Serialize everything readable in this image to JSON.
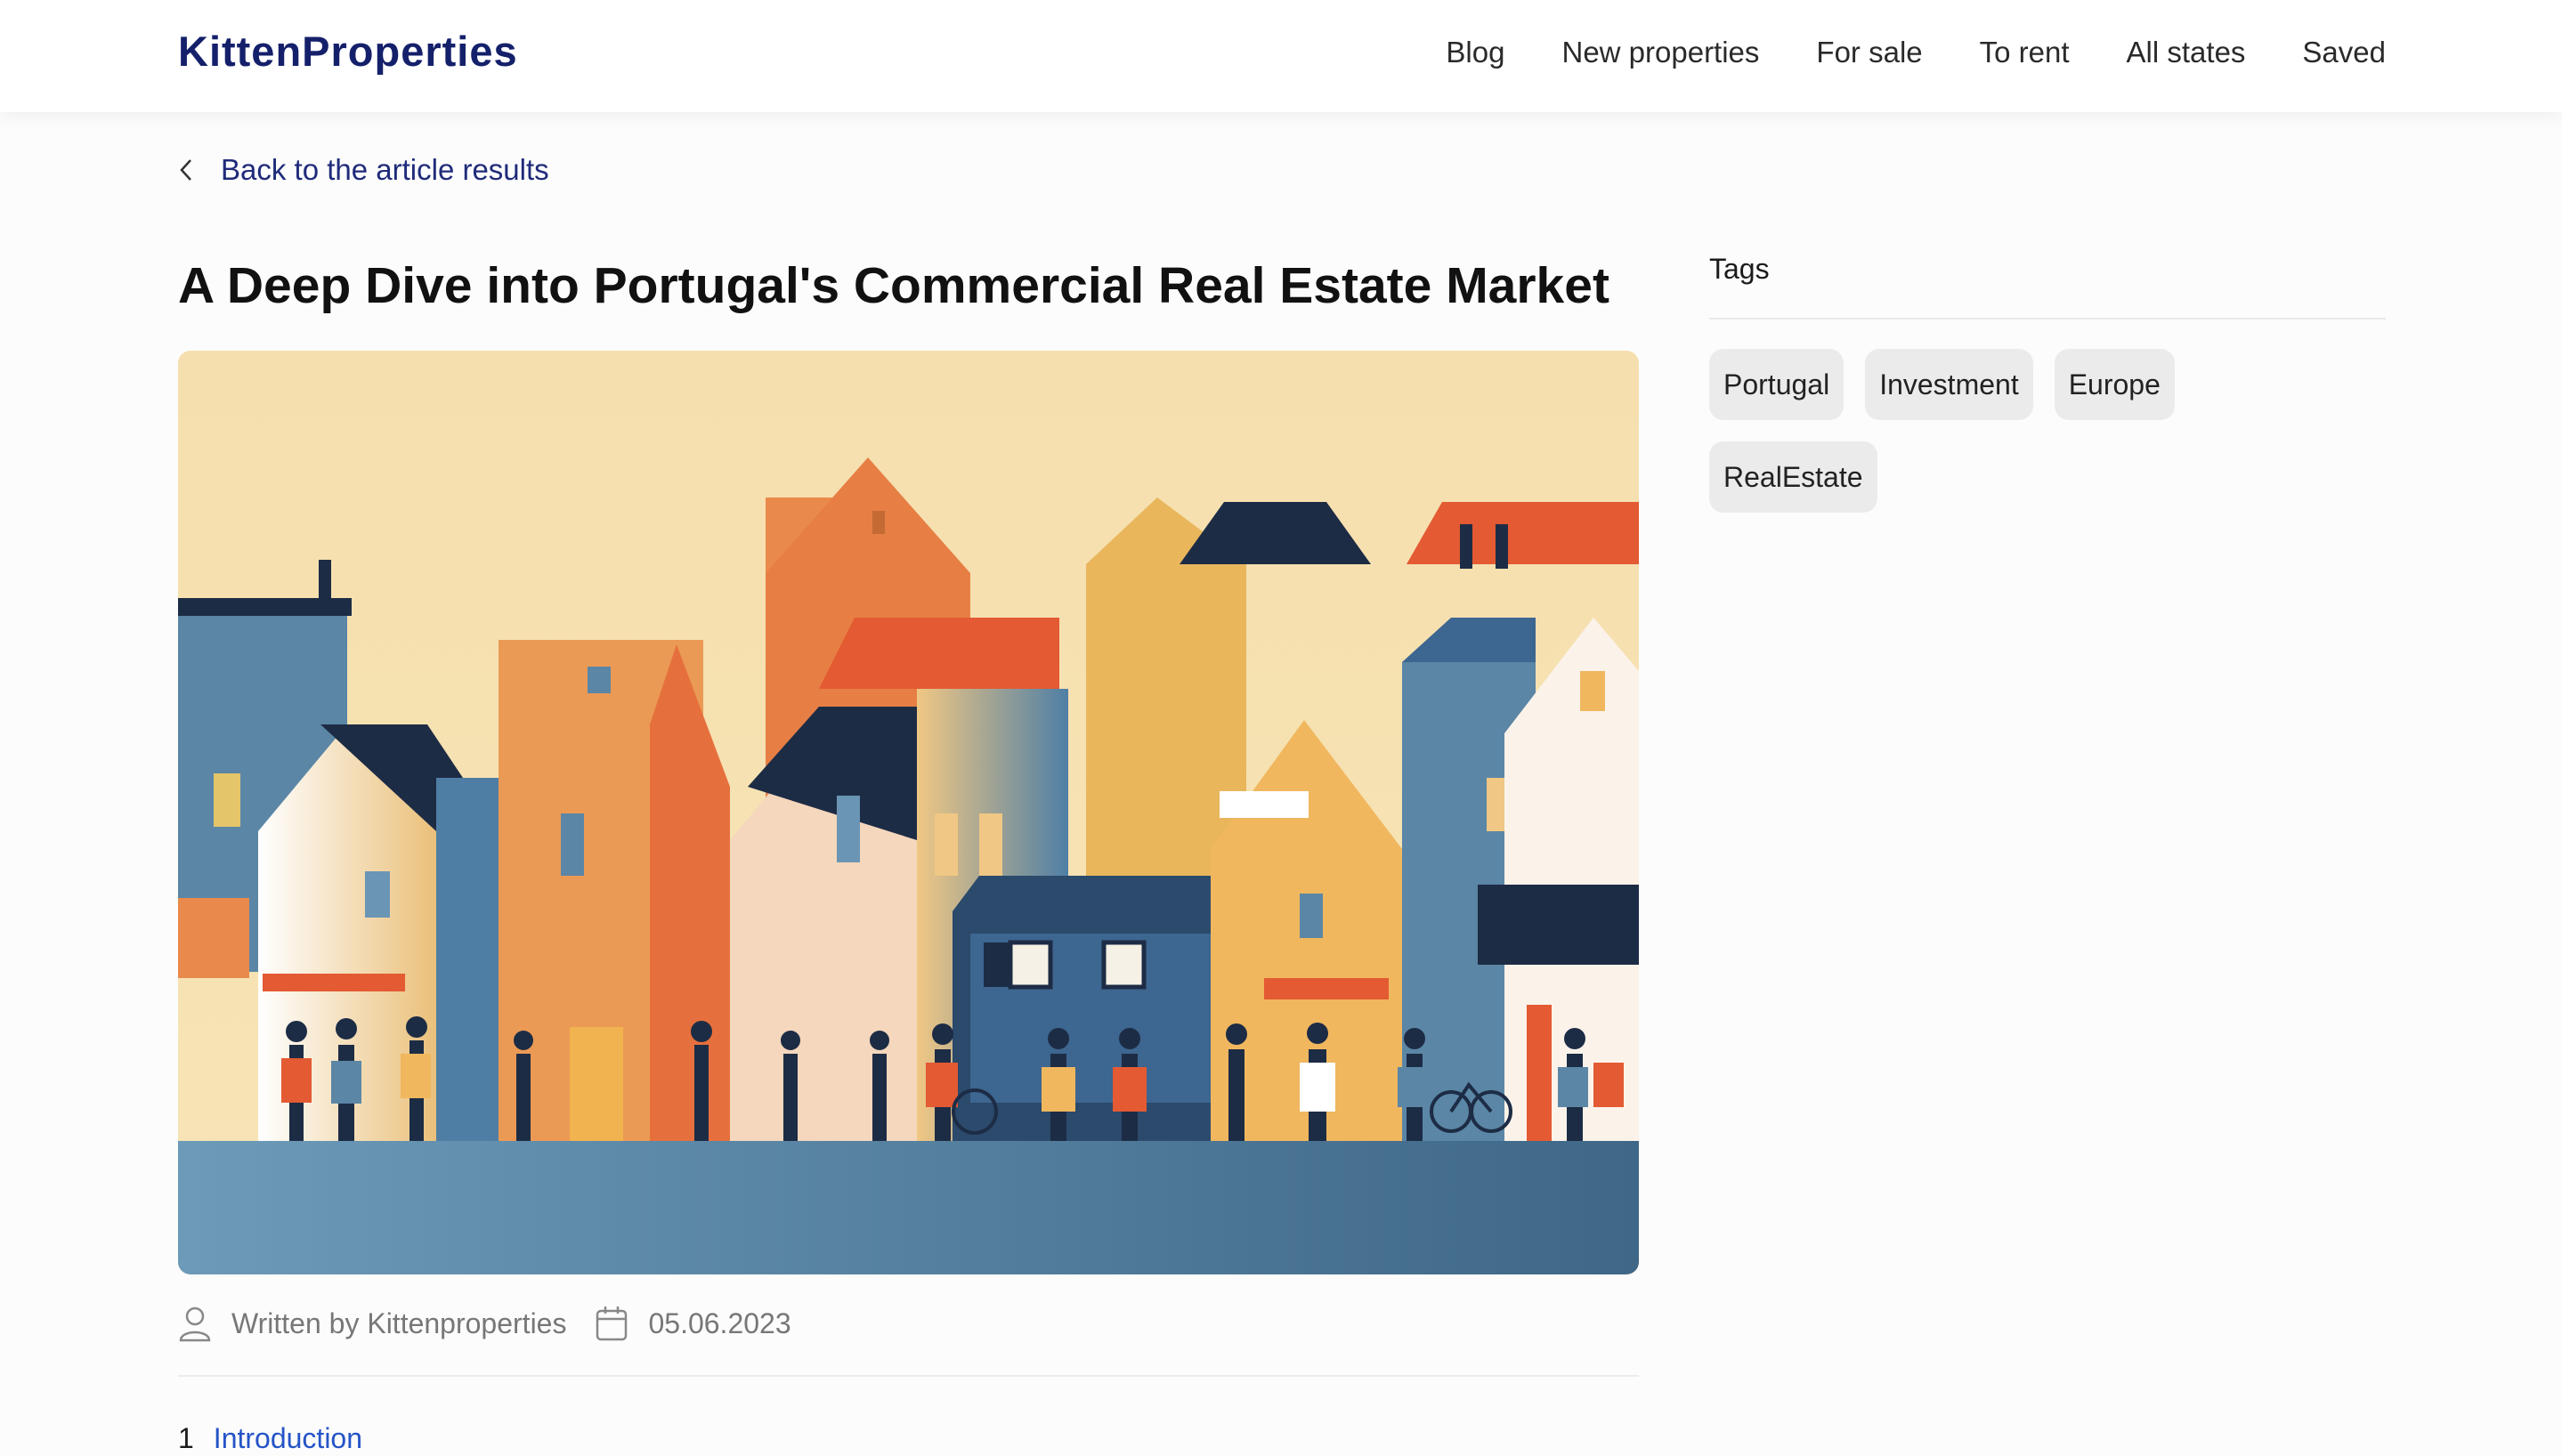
{
  "header": {
    "logo": "KittenProperties",
    "nav": [
      "Blog",
      "New properties",
      "For sale",
      "To rent",
      "All states",
      "Saved"
    ]
  },
  "back_link": {
    "label": "Back to the article results",
    "icon": "chevron-left-icon"
  },
  "article": {
    "title": "A Deep Dive into Portugal's Commercial Real Estate Market",
    "hero_image": "illustration-colorful-houses-with-people",
    "author": "Written by Kittenproperties",
    "date": "05.06.2023",
    "toc": [
      {
        "number": "1",
        "label": "Introduction"
      }
    ]
  },
  "sidebar": {
    "tags_title": "Tags",
    "tags": [
      "Portugal",
      "Investment",
      "Europe",
      "RealEstate"
    ]
  },
  "colors": {
    "logo": "#15206b",
    "link": "#2554c7",
    "back_link": "#1f2b7a",
    "tag_bg": "#ebebeb"
  }
}
